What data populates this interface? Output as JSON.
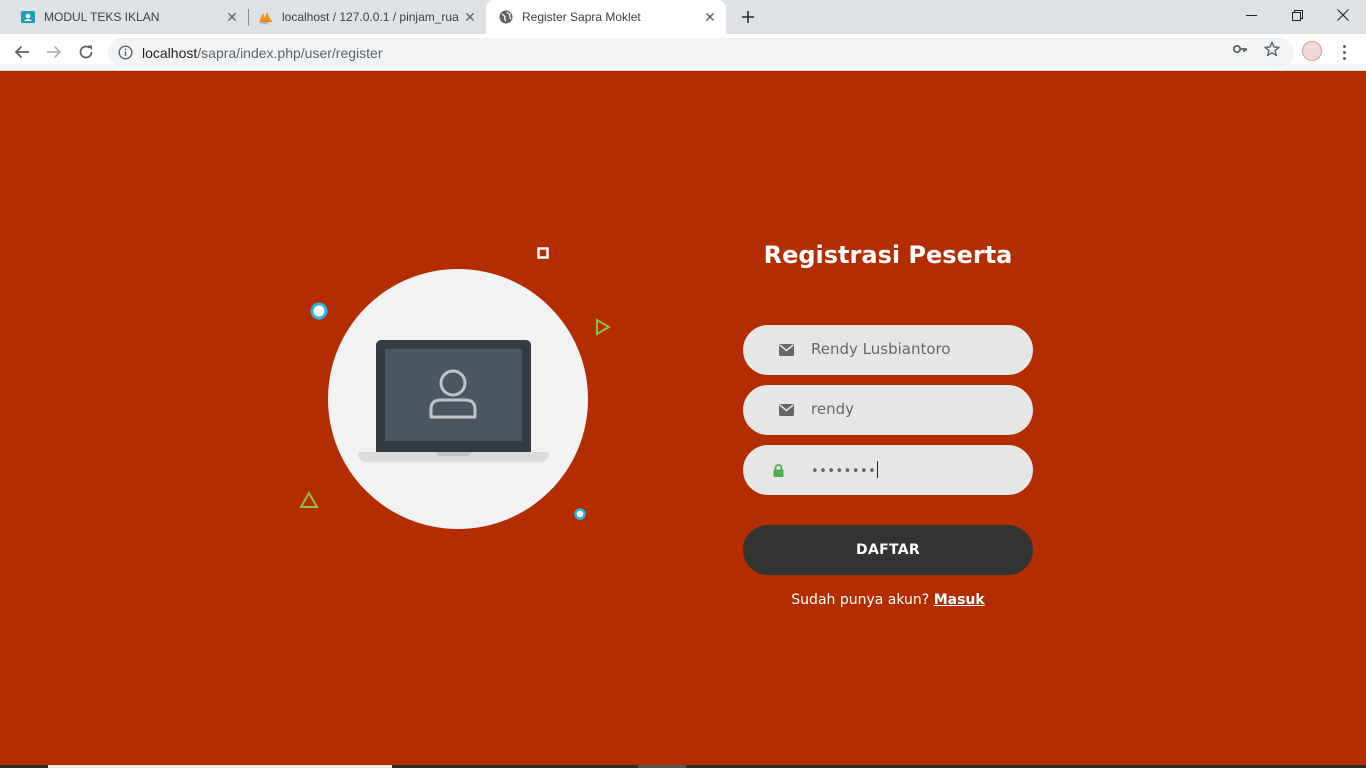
{
  "browser": {
    "tabs": [
      {
        "title": "MODUL TEKS IKLAN",
        "favicon": "classroom-icon",
        "active": false
      },
      {
        "title": "localhost / 127.0.0.1 / pinjam_rua",
        "favicon": "phpmyadmin-icon",
        "active": false
      },
      {
        "title": "Register Sapra Moklet",
        "favicon": "globe-icon",
        "active": true
      }
    ],
    "address": {
      "host": "localhost",
      "path": "/sapra/index.php/user/register"
    },
    "colors": {
      "tabstrip": "#dee1e6",
      "toolbar": "#ffffff",
      "omnibox": "#f1f3f4"
    }
  },
  "page": {
    "background": "#b32d00",
    "illustration": {
      "circle_color": "#f2f2f2",
      "icon": "laptop-user-icon"
    },
    "form": {
      "title": "Registrasi Peserta",
      "fields": [
        {
          "icon": "envelope-icon",
          "value": "Rendy Lusbiantoro"
        },
        {
          "icon": "envelope-icon",
          "value": "rendy"
        },
        {
          "icon": "lock-icon",
          "value": "••••••••"
        }
      ],
      "submit_label": "DAFTAR",
      "login_prompt": "Sudah punya akun?",
      "login_link": "Masuk"
    }
  }
}
